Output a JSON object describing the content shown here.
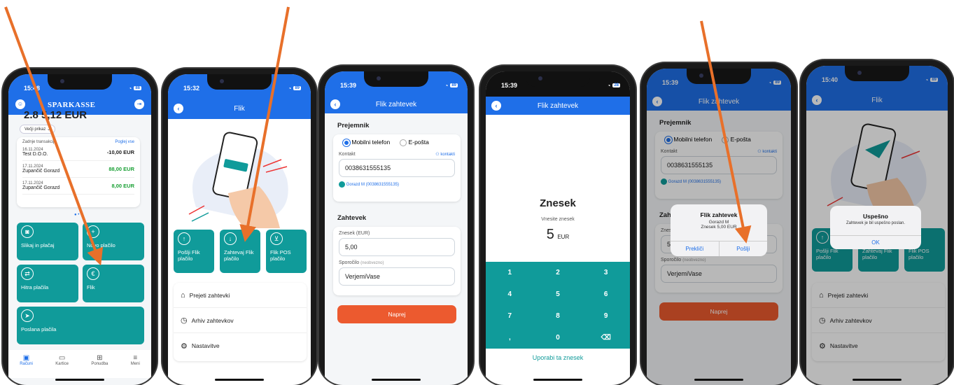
{
  "colors": {
    "brand_blue": "#1f6fe8",
    "teal": "#109b9a",
    "orange": "#ec5a2f",
    "arrow": "#e8702a"
  },
  "p1": {
    "time": "15:48",
    "brand": "SPARKASSE",
    "balance": "2.8 5,12 EUR",
    "toggle": "Večji prikaz",
    "recent": "Zadnje transakcije",
    "see_all": "Poglej vse",
    "tx": [
      {
        "date": "16.11.2024",
        "name": "Test D.O.O.",
        "amt": "-10,00 EUR",
        "color": "#222"
      },
      {
        "date": "17.11.2024",
        "name": "Zupančič Gorazd",
        "amt": "88,00 EUR",
        "color": "#1aa035"
      },
      {
        "date": "17.11.2024",
        "name": "Zupančič Gorazd",
        "amt": "8,00 EUR",
        "color": "#1aa035"
      }
    ],
    "tiles": [
      "Slikaj in plačaj",
      "Novo plačilo",
      "Hitra plačila",
      "Flik",
      "Poslana plačila"
    ],
    "nav": [
      "Računi",
      "Kartice",
      "Ponudba",
      "Meni"
    ]
  },
  "p2": {
    "time": "15:32",
    "title": "Flik",
    "tiles": [
      "Pošlji Flik plačilo",
      "Zahtevaj Flik plačilo",
      "Flik POS plačilo"
    ],
    "menu": [
      "Prejeti zahtevki",
      "Arhiv zahtevkov",
      "Nastavitve"
    ]
  },
  "p3": {
    "time": "15:39",
    "title": "Flik zahtevek",
    "recipient": "Prejemnik",
    "opt_phone": "Mobilni telefon",
    "opt_email": "E-pošta",
    "contact": "Kontakt",
    "contacts_link": "kontakti",
    "phone": "0038631555135",
    "chip": "Gorazd M (0038631555135)",
    "request": "Zahtevek",
    "amount_label": "Znesek (EUR)",
    "amount": "5,00",
    "msg_label": "Sporočilo",
    "optional": "(neobvezno)",
    "msg": "VerjemiVase",
    "next": "Naprej"
  },
  "p4": {
    "time": "15:39",
    "title": "Flik zahtevek",
    "heading": "Znesek",
    "sub": "Vnesite znesek",
    "value": "5",
    "currency": "EUR",
    "keys": [
      "1",
      "2",
      "3",
      "4",
      "5",
      "6",
      "7",
      "8",
      "9",
      ",",
      "0",
      "⌫"
    ],
    "use": "Uporabi ta znesek"
  },
  "p5": {
    "time": "15:39",
    "title": "Flik zahtevek",
    "dlg_title": "Flik zahtevek",
    "dlg_name": "Gorazd M",
    "dlg_amount": "Znesek 5,00 EUR",
    "cancel": "Prekliči",
    "send": "Pošlji"
  },
  "p6": {
    "time": "15:40",
    "title": "Flik",
    "dlg_title": "Uspešno",
    "dlg_msg": "Zahtevek je bil uspešno poslan.",
    "ok": "OK"
  }
}
